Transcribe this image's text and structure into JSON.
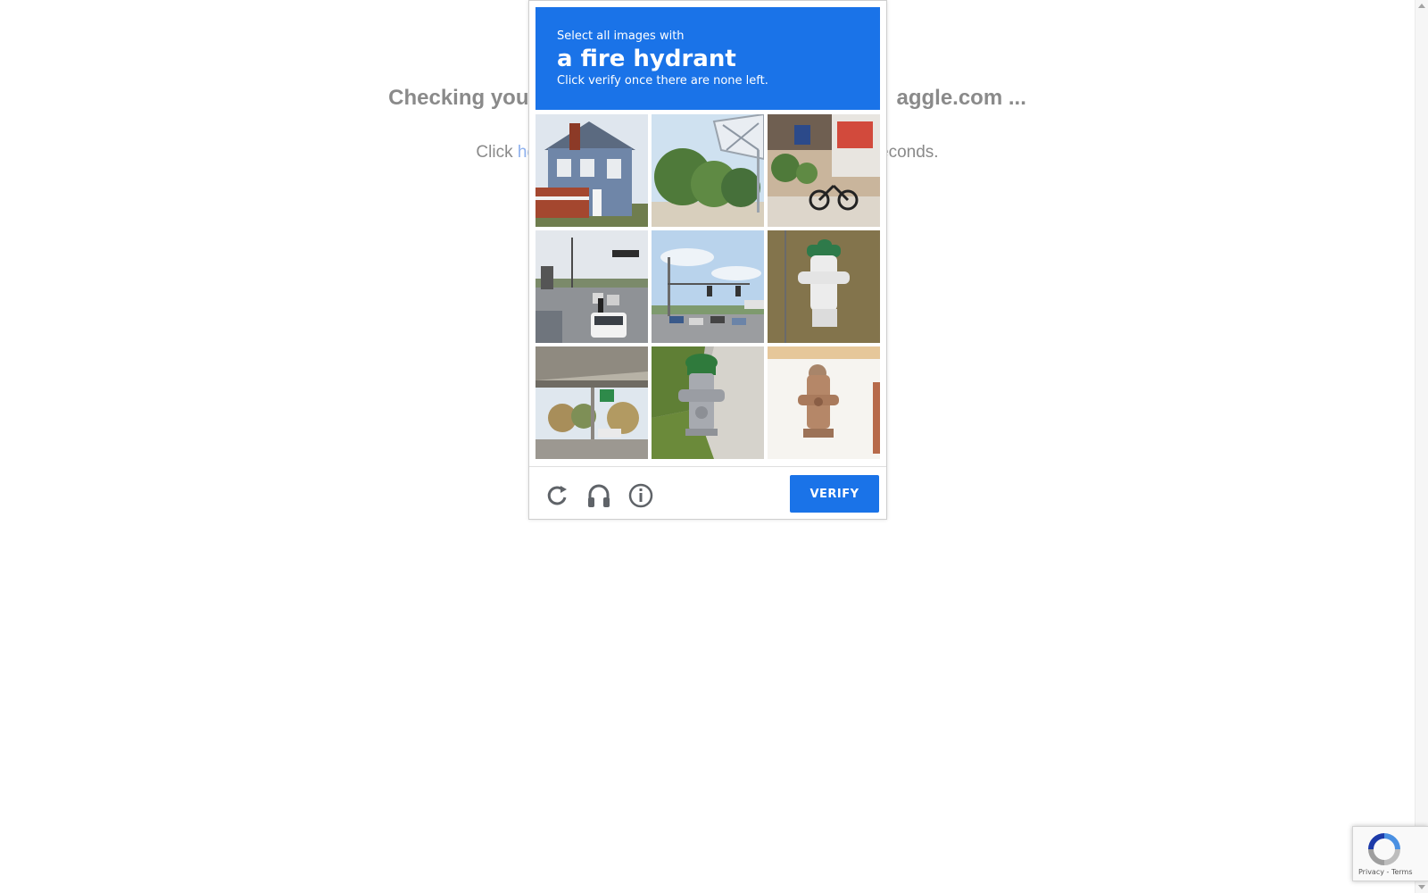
{
  "page": {
    "heading_start": "Checking you",
    "heading_end": "aggle.com ...",
    "click_prefix": "Click ",
    "click_link": "he",
    "click_suffix": "econds."
  },
  "challenge": {
    "instruction": "Select all images with",
    "target": "a fire hydrant",
    "hint": "Click verify once there are none left.",
    "tiles": [
      {
        "subject": "house with porch"
      },
      {
        "subject": "trees and billboard"
      },
      {
        "subject": "storefront with bicycle"
      },
      {
        "subject": "highway traffic"
      },
      {
        "subject": "intersection with traffic lights"
      },
      {
        "subject": "white fire hydrant"
      },
      {
        "subject": "overpass"
      },
      {
        "subject": "green fire hydrant"
      },
      {
        "subject": "rusty fire hydrant"
      }
    ],
    "footer": {
      "reload_icon": "reload-icon",
      "audio_icon": "headphones-icon",
      "info_icon": "info-icon",
      "verify_label": "VERIFY"
    },
    "colors": {
      "accent": "#1a73e8"
    }
  },
  "badge": {
    "links": "Privacy - Terms"
  }
}
